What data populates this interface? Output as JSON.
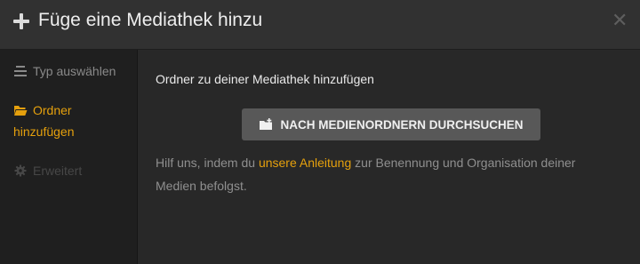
{
  "dialog": {
    "title": "Füge eine Mediathek hinzu",
    "plus_icon": "plus-icon",
    "close_icon": "close-icon"
  },
  "sidebar": {
    "items": [
      {
        "label": "Typ auswählen",
        "icon": "list-icon",
        "state": "completed"
      },
      {
        "label_line1": "Ordner",
        "label_line2": "hinzufügen",
        "icon": "folder-open-icon",
        "state": "active"
      },
      {
        "label": "Erweitert",
        "icon": "gear-icon",
        "state": "disabled"
      }
    ]
  },
  "main": {
    "section_label": "Ordner zu deiner Mediathek hinzufügen",
    "browse_button": {
      "label": "NACH MEDIENORDNERN DURCHSUCHEN",
      "icon": "folder-add-icon"
    },
    "help": {
      "prefix": "Hilf uns, indem du",
      "link": "unsere Anleitung",
      "suffix": "zur Benennung und Organisation deiner Medien befolgst."
    }
  },
  "colors": {
    "accent": "#e5a00d",
    "background": "#282828",
    "sidebar": "#1f1f1f",
    "header": "#313131",
    "button": "#585858"
  }
}
